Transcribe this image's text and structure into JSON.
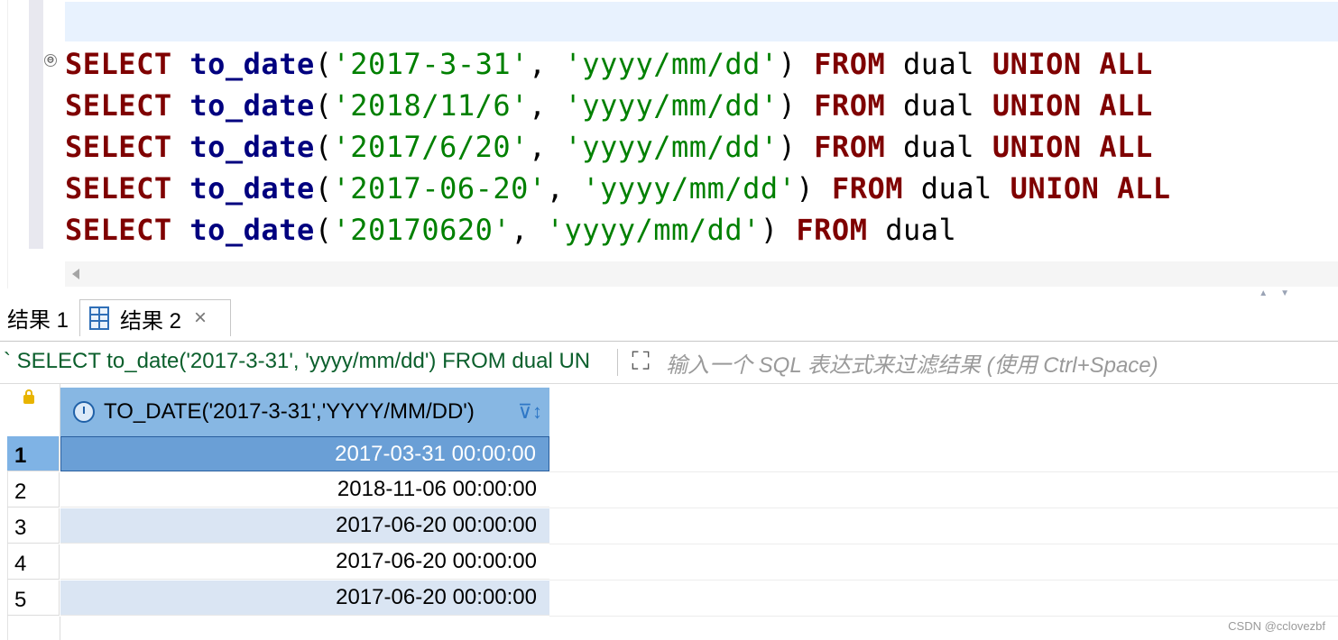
{
  "editor": {
    "lines": [
      [
        {
          "t": "SELECT ",
          "c": "kw"
        },
        {
          "t": "to_date",
          "c": "fn"
        },
        {
          "t": "(",
          "c": "plain"
        },
        {
          "t": "'2017-3-31'",
          "c": "str"
        },
        {
          "t": ", ",
          "c": "plain"
        },
        {
          "t": "'yyyy/mm/dd'",
          "c": "str"
        },
        {
          "t": ") ",
          "c": "plain"
        },
        {
          "t": "FROM ",
          "c": "kw"
        },
        {
          "t": "dual ",
          "c": "plain"
        },
        {
          "t": "UNION ALL",
          "c": "kw"
        }
      ],
      [
        {
          "t": "SELECT ",
          "c": "kw"
        },
        {
          "t": "to_date",
          "c": "fn"
        },
        {
          "t": "(",
          "c": "plain"
        },
        {
          "t": "'2018/11/6'",
          "c": "str"
        },
        {
          "t": ", ",
          "c": "plain"
        },
        {
          "t": "'yyyy/mm/dd'",
          "c": "str"
        },
        {
          "t": ") ",
          "c": "plain"
        },
        {
          "t": "FROM ",
          "c": "kw"
        },
        {
          "t": "dual ",
          "c": "plain"
        },
        {
          "t": "UNION ALL",
          "c": "kw"
        }
      ],
      [
        {
          "t": "SELECT ",
          "c": "kw"
        },
        {
          "t": "to_date",
          "c": "fn"
        },
        {
          "t": "(",
          "c": "plain"
        },
        {
          "t": "'2017/6/20'",
          "c": "str"
        },
        {
          "t": ", ",
          "c": "plain"
        },
        {
          "t": "'yyyy/mm/dd'",
          "c": "str"
        },
        {
          "t": ") ",
          "c": "plain"
        },
        {
          "t": "FROM ",
          "c": "kw"
        },
        {
          "t": "dual ",
          "c": "plain"
        },
        {
          "t": "UNION ALL",
          "c": "kw"
        }
      ],
      [
        {
          "t": "SELECT ",
          "c": "kw"
        },
        {
          "t": "to_date",
          "c": "fn"
        },
        {
          "t": "(",
          "c": "plain"
        },
        {
          "t": "'2017-06-20'",
          "c": "str"
        },
        {
          "t": ", ",
          "c": "plain"
        },
        {
          "t": "'yyyy/mm/dd'",
          "c": "str"
        },
        {
          "t": ") ",
          "c": "plain"
        },
        {
          "t": "FROM ",
          "c": "kw"
        },
        {
          "t": "dual ",
          "c": "plain"
        },
        {
          "t": "UNION ALL",
          "c": "kw"
        }
      ],
      [
        {
          "t": "SELECT ",
          "c": "kw"
        },
        {
          "t": "to_date",
          "c": "fn"
        },
        {
          "t": "(",
          "c": "plain"
        },
        {
          "t": "'20170620'",
          "c": "str"
        },
        {
          "t": ", ",
          "c": "plain"
        },
        {
          "t": "'yyyy/mm/dd'",
          "c": "str"
        },
        {
          "t": ") ",
          "c": "plain"
        },
        {
          "t": "FROM ",
          "c": "kw"
        },
        {
          "t": "dual",
          "c": "plain"
        }
      ]
    ],
    "fold_glyph": "⊖",
    "colors": {
      "keyword": "#7f0000",
      "function": "#00007f",
      "string": "#008000"
    }
  },
  "results": {
    "tabs": [
      {
        "label": "结果 1",
        "active": false
      },
      {
        "label": "结果 2",
        "active": true
      }
    ],
    "close_glyph": "×",
    "panel_arrows": "▲▼",
    "query_text": "` SELECT to_date('2017-3-31', 'yyyy/mm/dd') FROM dual UN",
    "expand_glyph": "⛶",
    "filter_placeholder": "输入一个 SQL 表达式来过滤结果 (使用 Ctrl+Space)",
    "column_header": "TO_DATE('2017-3-31','YYYY/MM/DD')",
    "filter_sort_glyph": "⊽↕",
    "rows": [
      {
        "num": "1",
        "value": "2017-03-31 00:00:00",
        "selected": true
      },
      {
        "num": "2",
        "value": "2018-11-06 00:00:00",
        "selected": false
      },
      {
        "num": "3",
        "value": "2017-06-20 00:00:00",
        "selected": false
      },
      {
        "num": "4",
        "value": "2017-06-20 00:00:00",
        "selected": false
      },
      {
        "num": "5",
        "value": "2017-06-20 00:00:00",
        "selected": false
      }
    ]
  },
  "watermark": "CSDN @cclovezbf"
}
